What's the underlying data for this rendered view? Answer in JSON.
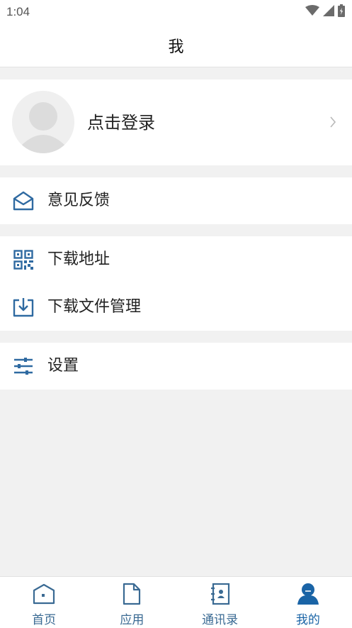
{
  "status_bar": {
    "time": "1:04",
    "icons": [
      "wifi-icon",
      "signal-icon",
      "battery-icon"
    ]
  },
  "header": {
    "title": "我"
  },
  "profile": {
    "login_label": "点击登录",
    "avatar_icon": "user-avatar-icon",
    "arrow_icon": "chevron-right-icon"
  },
  "menu": {
    "feedback": {
      "label": "意见反馈",
      "icon": "mail-open-icon"
    },
    "download_address": {
      "label": "下载地址",
      "icon": "qr-code-icon"
    },
    "download_manager": {
      "label": "下载文件管理",
      "icon": "download-tray-icon"
    },
    "settings": {
      "label": "设置",
      "icon": "sliders-icon"
    }
  },
  "tabs": [
    {
      "label": "首页",
      "icon": "home-icon",
      "active": false
    },
    {
      "label": "应用",
      "icon": "document-icon",
      "active": false
    },
    {
      "label": "通讯录",
      "icon": "contacts-book-icon",
      "active": false
    },
    {
      "label": "我的",
      "icon": "person-icon",
      "active": true
    }
  ],
  "colors": {
    "accent": "#1a64a6",
    "icon_blue": "#2f6aa1",
    "background": "#f1f1f1",
    "card": "#ffffff"
  }
}
